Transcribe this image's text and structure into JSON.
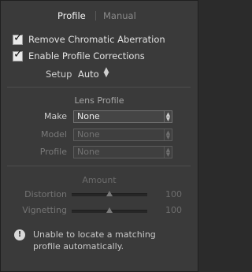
{
  "tabs": {
    "profile": "Profile",
    "manual": "Manual"
  },
  "options": {
    "remove_ca": {
      "label": "Remove Chromatic Aberration",
      "checked": true
    },
    "enable_profile": {
      "label": "Enable Profile Corrections",
      "checked": true
    }
  },
  "setup": {
    "label": "Setup",
    "value": "Auto"
  },
  "lens_profile": {
    "title": "Lens Profile",
    "make": {
      "label": "Make",
      "value": "None"
    },
    "model": {
      "label": "Model",
      "value": "None"
    },
    "profile": {
      "label": "Profile",
      "value": "None"
    }
  },
  "amount": {
    "title": "Amount",
    "distortion": {
      "label": "Distortion",
      "value": "100",
      "level": 0.5
    },
    "vignetting": {
      "label": "Vignetting",
      "value": "100",
      "level": 0.5
    }
  },
  "warning": {
    "icon": "info-icon",
    "line1": "Unable to locate a matching",
    "line2": "profile automatically."
  }
}
